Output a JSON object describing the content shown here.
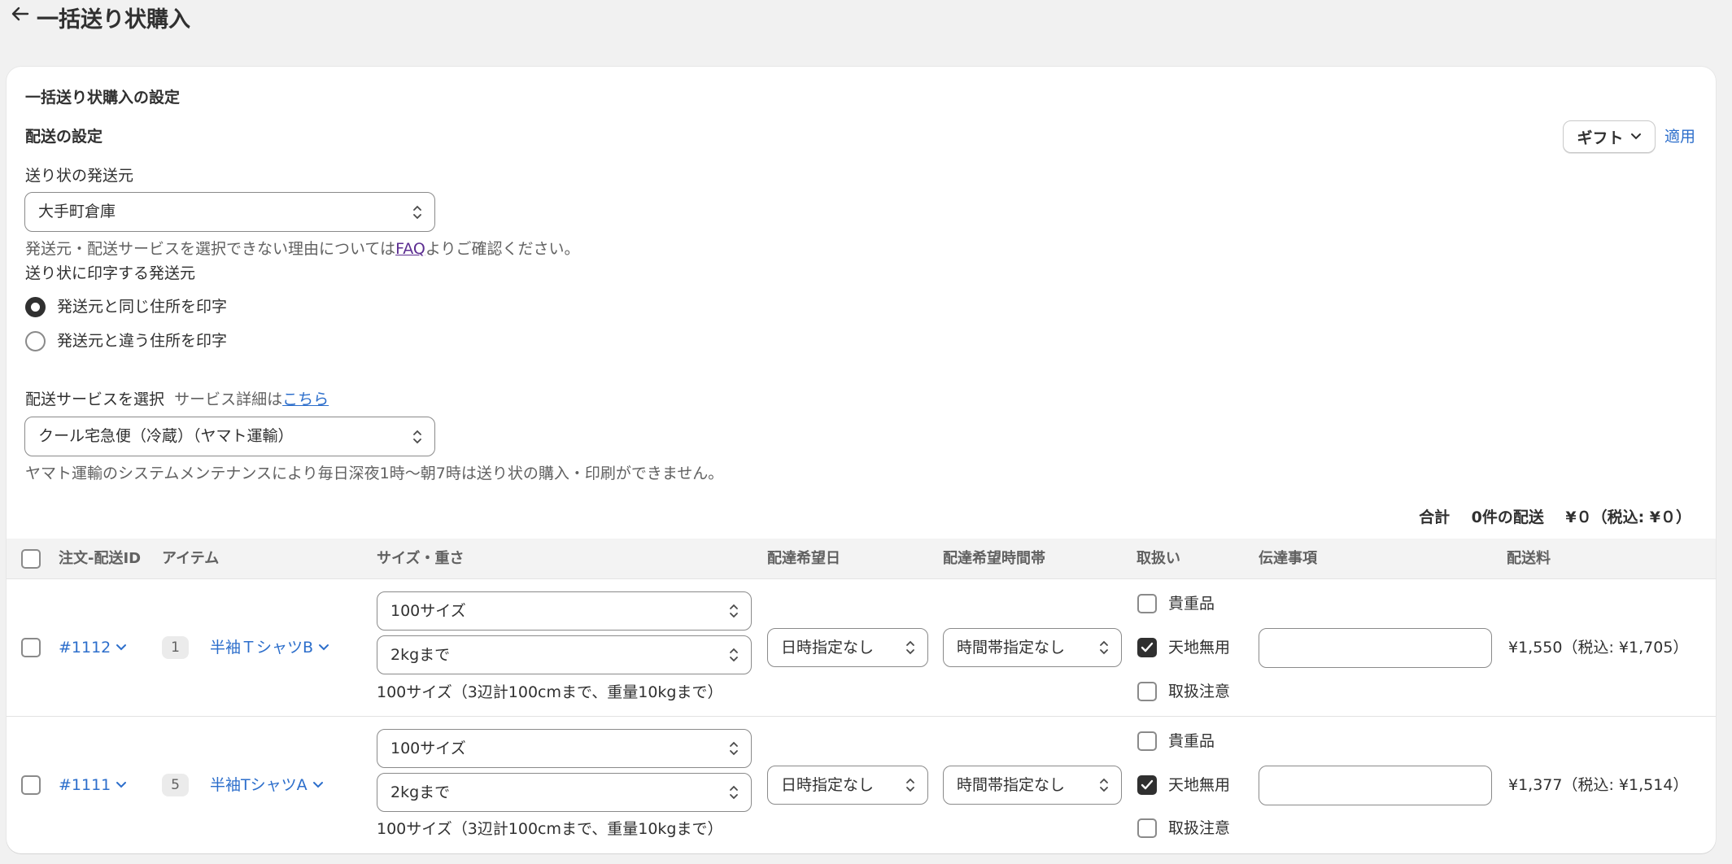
{
  "page": {
    "title": "一括送り状購入"
  },
  "settings": {
    "section_title": "一括送り状購入の設定",
    "shipping_title": "配送の設定",
    "gift_label": "ギフト",
    "apply_label": "適用",
    "origin_label": "送り状の発送元",
    "origin_value": "大手町倉庫",
    "origin_help_before": "発送元・配送サービスを選択できない理由については",
    "origin_help_link": "FAQ",
    "origin_help_after": "よりご確認ください。",
    "print_origin_label": "送り状に印字する発送元",
    "radio_same": "発送元と同じ住所を印字",
    "radio_different": "発送元と違う住所を印字",
    "service_label": "配送サービスを選択",
    "service_detail_prefix": "サービス詳細は",
    "service_detail_link": "こちら",
    "service_value": "クール宅急便（冷蔵）（ヤマト運輸）",
    "maintenance_note": "ヤマト運輸のシステムメンテナンスにより毎日深夜1時〜朝7時は送り状の購入・印刷ができません。"
  },
  "total": {
    "label": "合計",
    "count": "0件の配送",
    "amount": "¥０（税込: ¥０）"
  },
  "table": {
    "headers": {
      "order_id": "注文-配送ID",
      "item": "アイテム",
      "size_weight": "サイズ・重さ",
      "delivery_date": "配達希望日",
      "delivery_time": "配達希望時間帯",
      "handling": "取扱い",
      "message": "伝達事項",
      "fee": "配送料"
    },
    "rows": [
      {
        "order_id": "#1112",
        "qty": "1",
        "item": "半袖ＴシャツB",
        "size": "100サイズ",
        "weight": "2kgまで",
        "size_note": "100サイズ（3辺計100cmまで、重量10kgまで）",
        "date": "日時指定なし",
        "time": "時間帯指定なし",
        "handling_valuables": "貴重品",
        "handling_this_side_up": "天地無用",
        "handling_caution": "取扱注意",
        "fee": "¥1,550（税込: ¥1,705）"
      },
      {
        "order_id": "#1111",
        "qty": "5",
        "item": "半袖TシャツA",
        "size": "100サイズ",
        "weight": "2kgまで",
        "size_note": "100サイズ（3辺計100cmまで、重量10kgまで）",
        "date": "日時指定なし",
        "time": "時間帯指定なし",
        "handling_valuables": "貴重品",
        "handling_this_side_up": "天地無用",
        "handling_caution": "取扱注意",
        "fee": "¥1,377（税込: ¥1,514）"
      }
    ]
  }
}
